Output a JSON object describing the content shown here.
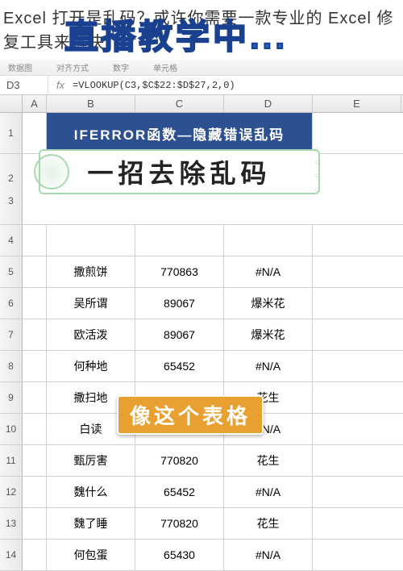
{
  "article_title": "Excel 打开是乱码？或许你需要一款专业的 Excel 修复工具来解决",
  "overlay_text": "直播教学中...",
  "toolbar": {
    "item1": "数据图",
    "item2": "对齐方式",
    "item3": "数字",
    "item4": "单元格"
  },
  "formula": {
    "cell": "D3",
    "fx": "fx",
    "value": "=VLOOKUP(C3,$C$22:$D$27,2,0)"
  },
  "cols": [
    "A",
    "B",
    "C",
    "D",
    "E"
  ],
  "rows": [
    "1",
    "2",
    "3",
    "4",
    "5",
    "6",
    "7",
    "8",
    "9",
    "10",
    "11",
    "12",
    "13",
    "14"
  ],
  "title_cell": "IFERROR函数—隐藏错误乱码",
  "banner": "一招去除乱码",
  "yellow_badge": "像这个表格",
  "table": [
    {
      "b": "撒煎饼",
      "c": "770863",
      "d": "#N/A"
    },
    {
      "b": "吴所谓",
      "c": "89067",
      "d": "爆米花"
    },
    {
      "b": "欧活泼",
      "c": "89067",
      "d": "爆米花"
    },
    {
      "b": "何种地",
      "c": "65452",
      "d": "#N/A"
    },
    {
      "b": "撒扫地",
      "c": "",
      "d": "花生"
    },
    {
      "b": "白读",
      "c": "",
      "d": "#N/A"
    },
    {
      "b": "甄厉害",
      "c": "770820",
      "d": "花生"
    },
    {
      "b": "魏什么",
      "c": "65452",
      "d": "#N/A"
    },
    {
      "b": "魏了睡",
      "c": "770820",
      "d": "花生"
    },
    {
      "b": "何包蛋",
      "c": "65430",
      "d": "#N/A"
    }
  ]
}
